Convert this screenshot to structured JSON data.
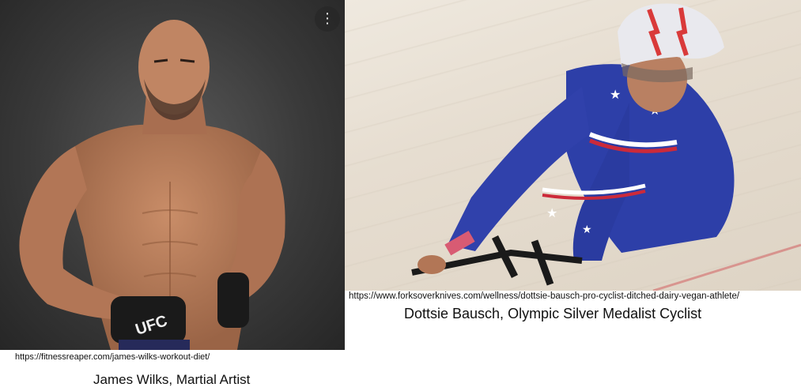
{
  "images": [
    {
      "subject": "James Wilks",
      "source_url": "https://fitnessreaper.com/james-wilks-workout-diet/",
      "caption": "James Wilks, Martial Artist",
      "glove_text": "UFC",
      "menu_icon": "more-vert-icon",
      "colors": {
        "background": "#333333",
        "skin": "#b97f5c",
        "glove": "#1a1a1a"
      }
    },
    {
      "subject": "Dottsie Bausch",
      "source_url": "https://www.forksoverknives.com/wellness/dottsie-bausch-pro-cyclist-ditched-dairy-vegan-athlete/",
      "caption": "Dottsie Bausch, Olympic Silver Medalist Cyclist",
      "colors": {
        "background": "#e8e0d4",
        "suit": "#2d3fa8",
        "helmet": "#e9e9ee"
      }
    }
  ]
}
